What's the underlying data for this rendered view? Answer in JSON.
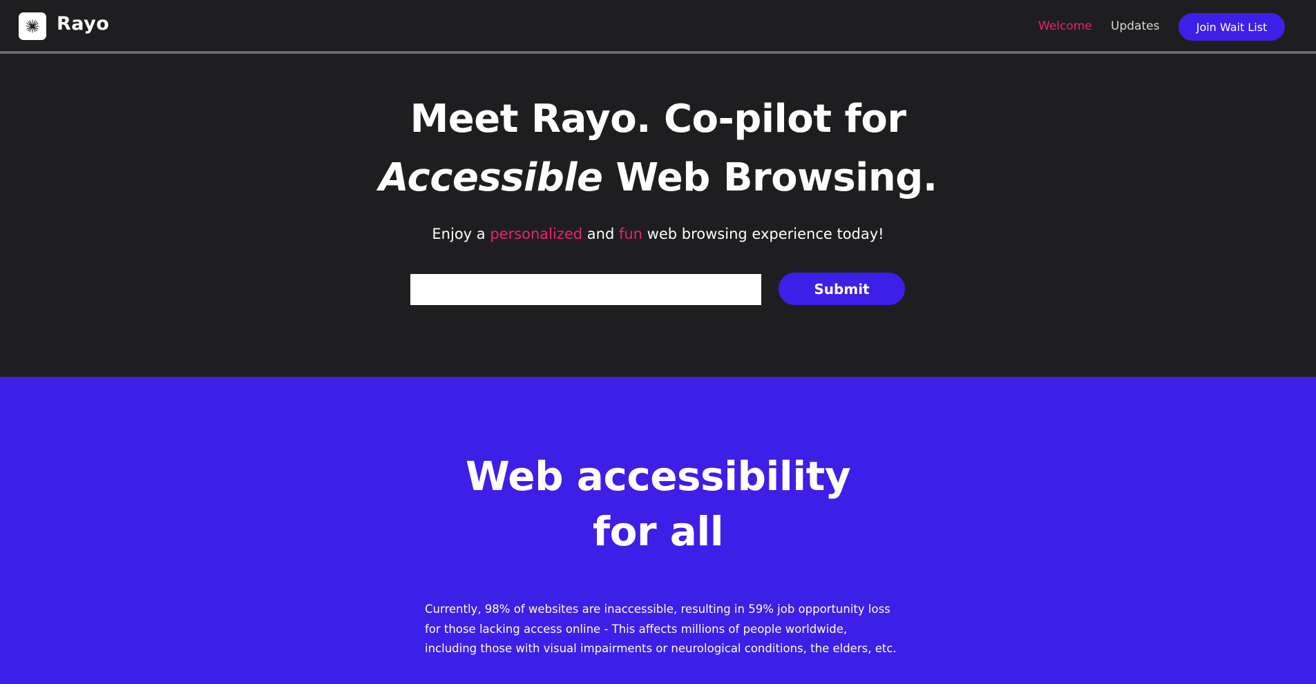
{
  "nav": {
    "brand": "Rayo",
    "welcome": "Welcome",
    "updates": "Updates",
    "cta": "Join Wait List"
  },
  "hero": {
    "line1": "Meet Rayo. Co-pilot for",
    "line2_italic": "Accessible",
    "line2_rest": " Web Browsing.",
    "sub_pre": "Enjoy a ",
    "sub_accent1": "personalized",
    "sub_mid": " and ",
    "sub_accent2": "fun",
    "sub_post": " web browsing experience today!",
    "email_placeholder": "",
    "submit": "Submit"
  },
  "section2": {
    "title_line1": "Web accessibility",
    "title_line2": "for all",
    "body": "Currently, 98% of websites are inaccessible, resulting in 59% job opportunity loss for those lacking access online - This affects millions of people worldwide, including those with visual impairments or neurological conditions, the elders, etc."
  },
  "colors": {
    "dark_bg": "#1e1e20",
    "brand_purple": "#3d1fe8",
    "accent_pink": "#e8266e"
  },
  "icons": {
    "logo": "rayo-spark-icon"
  }
}
